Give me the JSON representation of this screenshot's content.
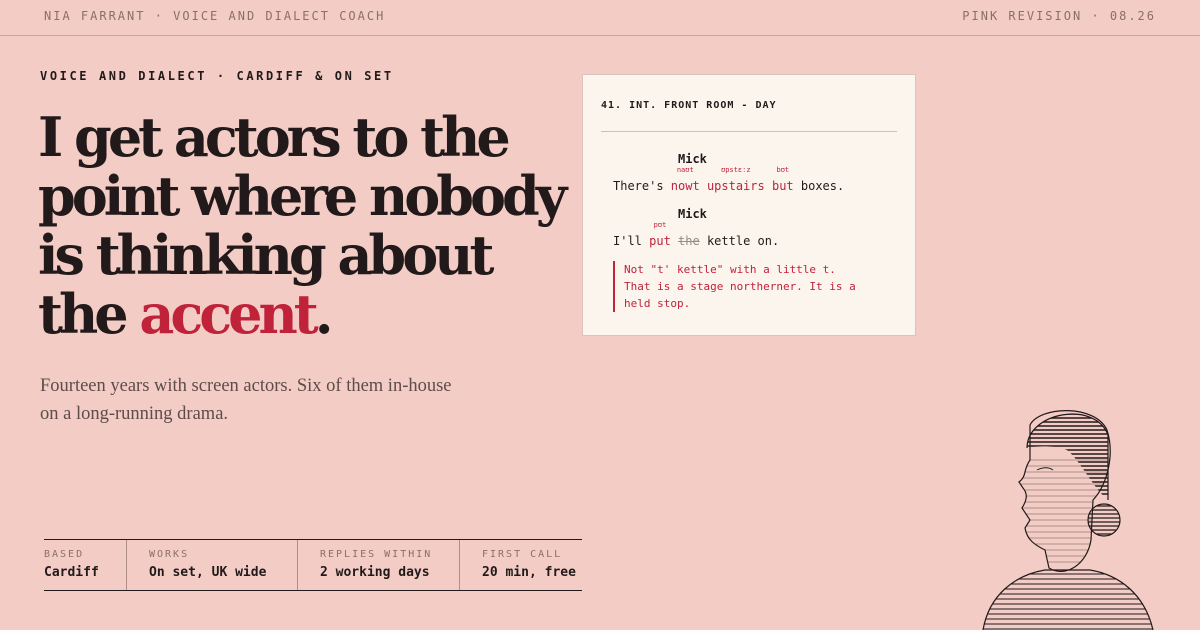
{
  "topbar": {
    "left": "NIA FARRANT · VOICE AND DIALECT COACH",
    "right": "PINK REVISION · 08.26"
  },
  "hero": {
    "eyebrow": "VOICE AND DIALECT · CARDIFF & ON SET",
    "headline_lines": [
      "I get actors to the",
      "point where nobody",
      "is thinking about",
      "the "
    ],
    "headline_accent": "accent",
    "headline_end": ".",
    "lede": "Fourteen years with screen actors. Six of them in-house on a long-running drama."
  },
  "facts": [
    {
      "label": "BASED",
      "value": "Cardiff"
    },
    {
      "label": "WORKS",
      "value": "On set, UK wide"
    },
    {
      "label": "REPLIES WITHIN",
      "value": "2 working days"
    },
    {
      "label": "FIRST CALL",
      "value": "20 min, free"
    }
  ],
  "script": {
    "slugline": "41. INT. FRONT ROOM - DAY",
    "block1": {
      "character": "Mick",
      "before": "There's ",
      "words": [
        {
          "text": "nowt",
          "ann": "naʊt"
        },
        {
          "text": "upstairs",
          "ann": "ʊpstɛːz"
        },
        {
          "text": "but",
          "ann": "bʊt"
        }
      ],
      "after": " boxes."
    },
    "block2": {
      "character": "Mick",
      "before": "I'll ",
      "put": "put",
      "put_ann": "pʊt",
      "struck": "the",
      "after": " kettle on."
    },
    "note": "Not \"t' kettle\" with a little t. That is a stage northerner. It is a held stop."
  },
  "colors": {
    "background": "#f2ccc5",
    "ink": "#221a1a",
    "accent": "#c0223a",
    "paper": "#fbf5ee"
  }
}
